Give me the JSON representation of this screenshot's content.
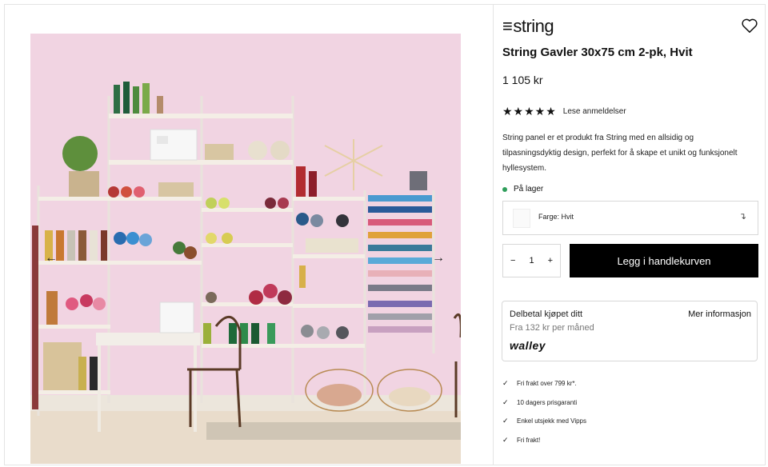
{
  "brand": {
    "name": "string",
    "logo_icon": "string-logo"
  },
  "product": {
    "title": "String Gavler 30x75 cm 2-pk, Hvit",
    "price": "1 105 kr",
    "rating": {
      "stars": "★★★★★",
      "value": 5,
      "reviews_label": "Lese anmeldelser"
    },
    "description": "String panel er et produkt fra String med en allsidig og tilpasningsdyktig design, perfekt for å skape et unikt og funksjonelt hyllesystem.",
    "stock": {
      "label": "På lager",
      "color": "#2f9e5b"
    },
    "color_select": {
      "label": "Farge: Hvit",
      "arrow": "↴"
    },
    "quantity": {
      "minus": "−",
      "value": "1",
      "plus": "+"
    },
    "add_to_cart": "Legg i handlekurven"
  },
  "gallery": {
    "prev": "←",
    "next": "→",
    "background": "#f1d4e2"
  },
  "financing": {
    "title": "Delbetal kjøpet ditt",
    "subtitle": "Fra 132 kr per måned",
    "more": "Mer informasjon",
    "logo": "walley"
  },
  "usps": [
    "Fri frakt over 799 kr*.",
    "10 dagers prisgaranti",
    "Enkel utsjekk med Vipps",
    "Fri frakt!"
  ],
  "icons": {
    "wishlist": "heart-icon",
    "check": "✓"
  }
}
